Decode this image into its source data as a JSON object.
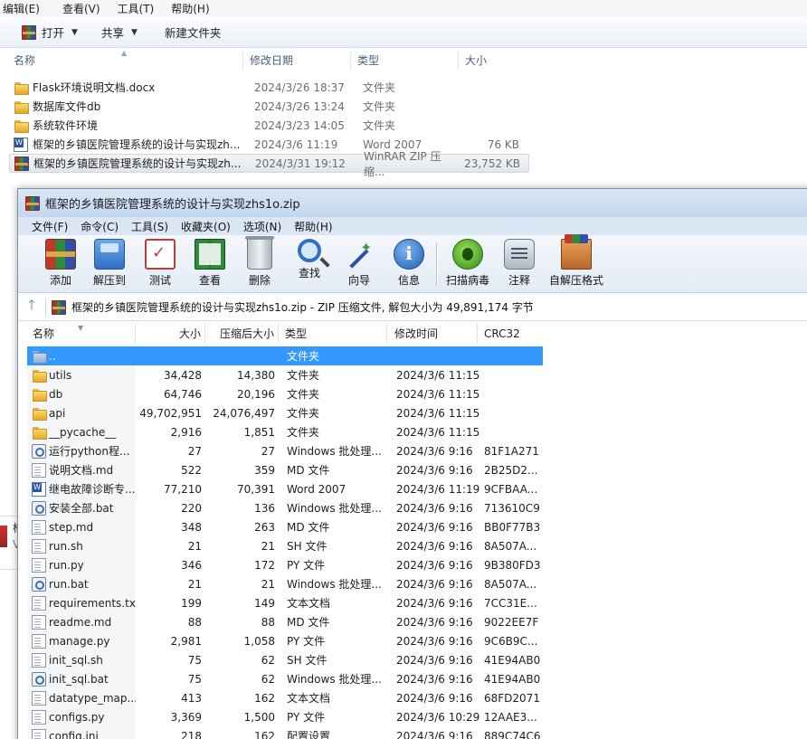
{
  "explorer": {
    "menu": [
      "编辑(E)",
      "查看(V)",
      "工具(T)",
      "帮助(H)"
    ],
    "toolbar": {
      "open_label": "打开",
      "share_label": "共享",
      "new_folder_label": "新建文件夹"
    },
    "columns": {
      "name": "名称",
      "date": "修改日期",
      "type": "类型",
      "size": "大小"
    },
    "files": [
      {
        "icon": "folder-icon",
        "name": "Flask环境说明文档.docx",
        "date": "2024/3/26 18:37",
        "type": "文件夹",
        "size": ""
      },
      {
        "icon": "folder-icon",
        "name": "数据库文件db",
        "date": "2024/3/26 13:24",
        "type": "文件夹",
        "size": ""
      },
      {
        "icon": "folder-icon",
        "name": "系统软件环境",
        "date": "2024/3/23 14:05",
        "type": "文件夹",
        "size": ""
      },
      {
        "icon": "word-doc-icon",
        "name": "框架的乡镇医院管理系统的设计与实现zh...",
        "date": "2024/3/6 11:19",
        "type": "Word 2007",
        "size": "76 KB"
      },
      {
        "icon": "winrar-archive-icon",
        "name": "框架的乡镇医院管理系统的设计与实现zh...",
        "date": "2024/3/31 19:12",
        "type": "WinRAR ZIP 压缩...",
        "size": "23,752 KB"
      }
    ]
  },
  "winrar": {
    "title": "框架的乡镇医院管理系统的设计与实现zhs1o.zip",
    "menu": [
      "文件(F)",
      "命令(C)",
      "工具(S)",
      "收藏夹(O)",
      "选项(N)",
      "帮助(H)"
    ],
    "toolbar": [
      {
        "label": "添加",
        "icon": "add-archive-icon"
      },
      {
        "label": "解压到",
        "icon": "extract-to-icon"
      },
      {
        "label": "测试",
        "icon": "test-icon"
      },
      {
        "label": "查看",
        "icon": "view-icon"
      },
      {
        "label": "删除",
        "icon": "delete-icon"
      },
      {
        "label": "查找",
        "icon": "find-icon"
      },
      {
        "label": "向导",
        "icon": "wizard-icon"
      },
      {
        "label": "信息",
        "icon": "info-icon"
      },
      {
        "label": "扫描病毒",
        "icon": "virus-scan-icon"
      },
      {
        "label": "注释",
        "icon": "comment-icon"
      },
      {
        "label": "自解压格式",
        "icon": "sfx-icon"
      }
    ],
    "address": "框架的乡镇医院管理系统的设计与实现zhs1o.zip - ZIP 压缩文件, 解包大小为 49,891,174 字节",
    "columns": {
      "name": "名称",
      "size": "大小",
      "packed": "压缩后大小",
      "type": "类型",
      "modified": "修改时间",
      "crc": "CRC32"
    },
    "files": [
      {
        "icon": "parent-folder-icon",
        "name": "..",
        "size": "",
        "packed": "",
        "type": "文件夹",
        "modified": "",
        "crc": "",
        "selected": true
      },
      {
        "icon": "folder-icon",
        "name": "utils",
        "size": "34,428",
        "packed": "14,380",
        "type": "文件夹",
        "modified": "2024/3/6 11:15",
        "crc": ""
      },
      {
        "icon": "folder-icon",
        "name": "db",
        "size": "64,746",
        "packed": "20,196",
        "type": "文件夹",
        "modified": "2024/3/6 11:15",
        "crc": ""
      },
      {
        "icon": "folder-icon",
        "name": "api",
        "size": "49,702,951",
        "packed": "24,076,497",
        "type": "文件夹",
        "modified": "2024/3/6 11:15",
        "crc": ""
      },
      {
        "icon": "folder-icon",
        "name": "__pycache__",
        "size": "2,916",
        "packed": "1,851",
        "type": "文件夹",
        "modified": "2024/3/6 11:15",
        "crc": ""
      },
      {
        "icon": "batch-file-icon",
        "name": "运行python程...",
        "size": "27",
        "packed": "27",
        "type": "Windows 批处理...",
        "modified": "2024/3/6 9:16",
        "crc": "81F1A271"
      },
      {
        "icon": "text-file-icon",
        "name": "说明文档.md",
        "size": "522",
        "packed": "359",
        "type": "MD 文件",
        "modified": "2024/3/6 9:16",
        "crc": "2B25D2..."
      },
      {
        "icon": "word-doc-icon",
        "name": "继电故障诊断专...",
        "size": "77,210",
        "packed": "70,391",
        "type": "Word 2007",
        "modified": "2024/3/6 11:19",
        "crc": "9CFBAA..."
      },
      {
        "icon": "batch-file-icon",
        "name": "安装全部.bat",
        "size": "220",
        "packed": "136",
        "type": "Windows 批处理...",
        "modified": "2024/3/6 9:16",
        "crc": "713610C9"
      },
      {
        "icon": "text-file-icon",
        "name": "step.md",
        "size": "348",
        "packed": "263",
        "type": "MD 文件",
        "modified": "2024/3/6 9:16",
        "crc": "BB0F77B3"
      },
      {
        "icon": "text-file-icon",
        "name": "run.sh",
        "size": "21",
        "packed": "21",
        "type": "SH 文件",
        "modified": "2024/3/6 9:16",
        "crc": "8A507A..."
      },
      {
        "icon": "text-file-icon",
        "name": "run.py",
        "size": "346",
        "packed": "172",
        "type": "PY 文件",
        "modified": "2024/3/6 9:16",
        "crc": "9B380FD3"
      },
      {
        "icon": "batch-file-icon",
        "name": "run.bat",
        "size": "21",
        "packed": "21",
        "type": "Windows 批处理...",
        "modified": "2024/3/6 9:16",
        "crc": "8A507A..."
      },
      {
        "icon": "text-file-icon",
        "name": "requirements.txt",
        "size": "199",
        "packed": "149",
        "type": "文本文档",
        "modified": "2024/3/6 9:16",
        "crc": "7CC31E..."
      },
      {
        "icon": "text-file-icon",
        "name": "readme.md",
        "size": "88",
        "packed": "88",
        "type": "MD 文件",
        "modified": "2024/3/6 9:16",
        "crc": "9022EE7F"
      },
      {
        "icon": "text-file-icon",
        "name": "manage.py",
        "size": "2,981",
        "packed": "1,058",
        "type": "PY 文件",
        "modified": "2024/3/6 9:16",
        "crc": "9C6B9C..."
      },
      {
        "icon": "text-file-icon",
        "name": "init_sql.sh",
        "size": "75",
        "packed": "62",
        "type": "SH 文件",
        "modified": "2024/3/6 9:16",
        "crc": "41E94AB0"
      },
      {
        "icon": "batch-file-icon",
        "name": "init_sql.bat",
        "size": "75",
        "packed": "62",
        "type": "Windows 批处理...",
        "modified": "2024/3/6 9:16",
        "crc": "41E94AB0"
      },
      {
        "icon": "text-file-icon",
        "name": "datatype_map....",
        "size": "413",
        "packed": "162",
        "type": "文本文档",
        "modified": "2024/3/6 9:16",
        "crc": "68FD2071"
      },
      {
        "icon": "text-file-icon",
        "name": "configs.py",
        "size": "3,369",
        "packed": "1,500",
        "type": "PY 文件",
        "modified": "2024/3/6 10:29",
        "crc": "12AAE3..."
      },
      {
        "icon": "text-file-icon",
        "name": "config.ini",
        "size": "218",
        "packed": "162",
        "type": "配置设置",
        "modified": "2024/3/6 9:16",
        "crc": "889C74C6"
      }
    ]
  },
  "peek": {
    "line1": "框",
    "line2": "V"
  }
}
